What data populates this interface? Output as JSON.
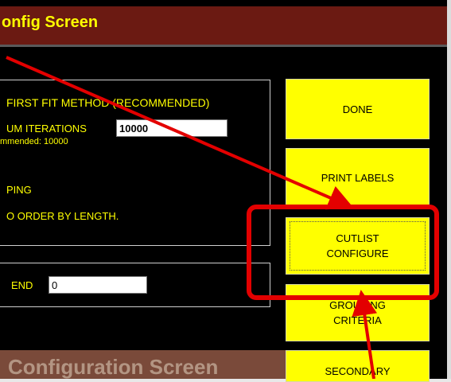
{
  "window": {
    "title": "onfig Screen"
  },
  "options": {
    "first_fit": "FIRST FIT METHOD (RECOMMENDED)",
    "iterations_label": "UM ITERATIONS",
    "iterations_value": "10000",
    "recommended_note": "mmended: 10000",
    "grouping_label": "PING",
    "order_label": "O ORDER BY LENGTH."
  },
  "end": {
    "label": "END",
    "value": "0"
  },
  "buttons": {
    "done": "DONE",
    "print_labels": "PRINT LABELS",
    "cutlist_line1": "CUTLIST",
    "cutlist_line2": "CONFIGURE",
    "grouping_line1": "GROUPING",
    "grouping_line2": "CRITERIA",
    "secondary": "SECONDARY"
  },
  "background_window": {
    "title": "Configuration Screen"
  },
  "colors": {
    "titlebar": "#6b1a12",
    "text": "#ffff00",
    "button": "#ffff00",
    "annotation": "#e30000"
  }
}
